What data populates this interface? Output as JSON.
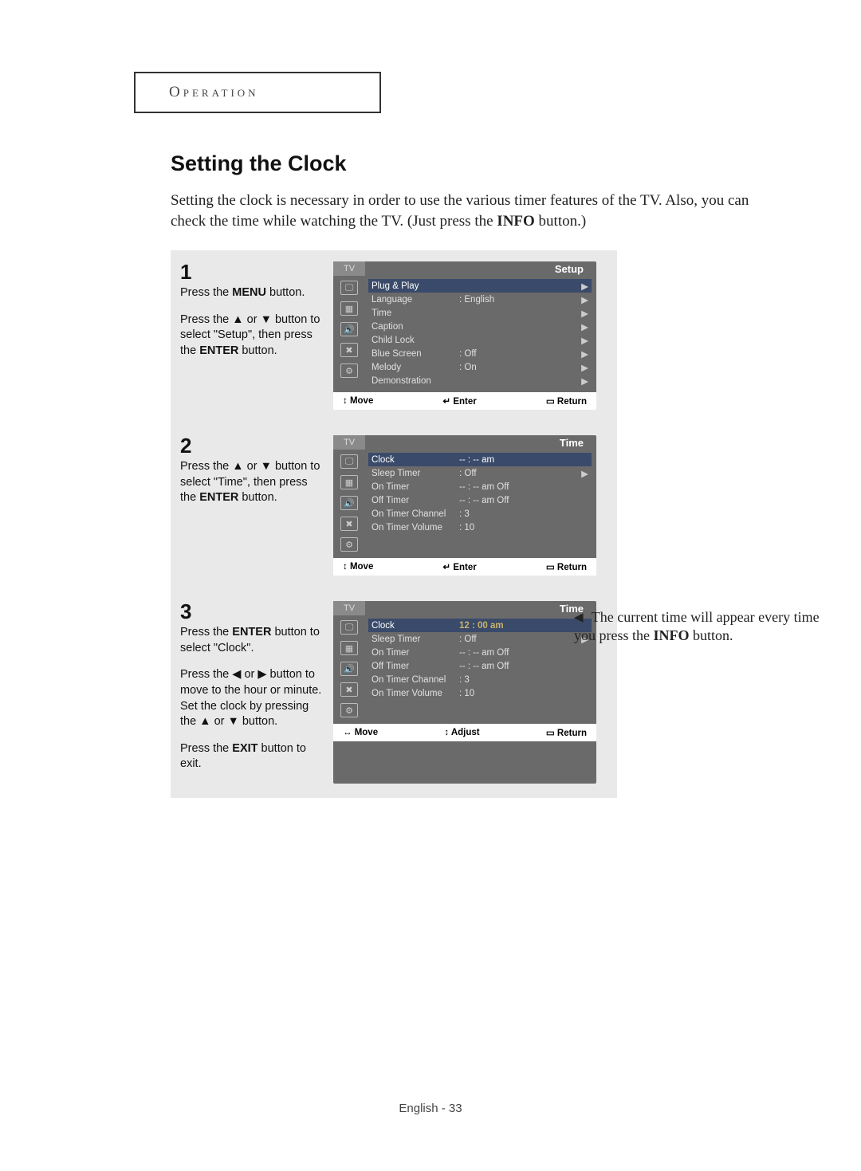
{
  "header": {
    "title": "Operation"
  },
  "section": {
    "title": "Setting the Clock",
    "intro_a": "Setting the clock is necessary in order to use the various timer features of the TV. Also, you can check the time while watching the TV. (Just press the ",
    "intro_b": "INFO",
    "intro_c": " button.)"
  },
  "steps": [
    {
      "num": "1",
      "paras": [
        [
          "Press the ",
          "MENU",
          " button."
        ],
        [
          "Press the ▲ or ▼ button to select \"Setup\", then press the ",
          "ENTER",
          " button."
        ]
      ]
    },
    {
      "num": "2",
      "paras": [
        [
          "Press the ▲ or ▼ button to select \"Time\", then press the ",
          "ENTER",
          " button."
        ]
      ]
    },
    {
      "num": "3",
      "paras": [
        [
          "Press the ",
          "ENTER",
          " button to select \"Clock\"."
        ],
        [
          "Press the ◀ or ▶ button to move to the hour or minute.  Set the clock by pressing the ▲ or ▼ button.",
          "",
          ""
        ],
        [
          "Press the ",
          "EXIT",
          " button to exit."
        ]
      ]
    }
  ],
  "osd_common": {
    "tab": "TV",
    "move": "Move",
    "enter": "Enter",
    "adjust": "Adjust",
    "return": "Return",
    "icons": [
      "picture-icon",
      "input-icon",
      "sound-icon",
      "setup-icon",
      "sliders-icon"
    ]
  },
  "osd": [
    {
      "title": "Setup",
      "rows": [
        {
          "label": "Plug & Play",
          "value": "",
          "arrow": "▶",
          "sel": true
        },
        {
          "label": "Language",
          "value": ":   English",
          "arrow": "▶"
        },
        {
          "label": "Time",
          "value": "",
          "arrow": "▶"
        },
        {
          "label": "Caption",
          "value": "",
          "arrow": "▶"
        },
        {
          "label": "Child Lock",
          "value": "",
          "arrow": "▶"
        },
        {
          "label": "Blue Screen",
          "value": ":   Off",
          "arrow": "▶"
        },
        {
          "label": "Melody",
          "value": ":   On",
          "arrow": "▶"
        },
        {
          "label": "Demonstration",
          "value": "",
          "arrow": "▶"
        }
      ],
      "footer": [
        "↕ Move",
        "↵ Enter",
        "▭ Return"
      ]
    },
    {
      "title": "Time",
      "rows": [
        {
          "label": "Clock",
          "value": "-- : -- am",
          "arrow": "",
          "sel": true
        },
        {
          "label": "Sleep Timer",
          "value": ":   Off",
          "arrow": "▶"
        },
        {
          "label": "On Timer",
          "value": "-- : -- am  Off",
          "arrow": ""
        },
        {
          "label": "Off Timer",
          "value": "-- : -- am  Off",
          "arrow": ""
        },
        {
          "label": "On Timer Channel",
          "value": ":            3",
          "arrow": ""
        },
        {
          "label": "On Timer Volume",
          "value": ":          10",
          "arrow": ""
        }
      ],
      "footer": [
        "↕ Move",
        "↵ Enter",
        "▭ Return"
      ]
    },
    {
      "title": "Time",
      "rows": [
        {
          "label": "Clock",
          "value": "12 : 00 am",
          "valueEm": true,
          "arrow": "",
          "sel": true
        },
        {
          "label": "Sleep Timer",
          "value": ":   Off",
          "arrow": "▶"
        },
        {
          "label": "On Timer",
          "value": "-- : -- am  Off",
          "arrow": ""
        },
        {
          "label": "Off Timer",
          "value": "-- : -- am  Off",
          "arrow": ""
        },
        {
          "label": "On Timer Channel",
          "value": ":            3",
          "arrow": ""
        },
        {
          "label": "On Timer Volume",
          "value": ":          10",
          "arrow": ""
        }
      ],
      "footer": [
        "↔ Move",
        "↕ Adjust",
        "▭ Return"
      ]
    }
  ],
  "side_note": {
    "arrow": "◀",
    "a": "The current time will appear every time you press the ",
    "b": "INFO",
    "c": " button."
  },
  "footer": {
    "text": "English - 33"
  }
}
